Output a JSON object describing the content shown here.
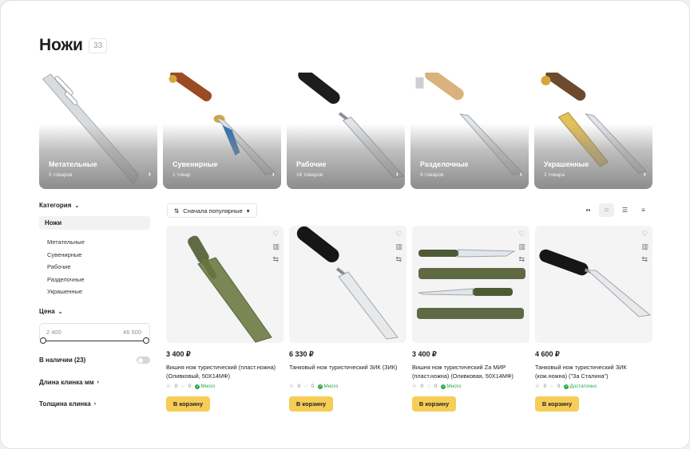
{
  "page": {
    "title": "Ножи",
    "total_count": "33"
  },
  "categories": [
    {
      "name": "Метательные",
      "count": "5 товаров"
    },
    {
      "name": "Сувенирные",
      "count": "1 товар"
    },
    {
      "name": "Рабочие",
      "count": "16 товаров"
    },
    {
      "name": "Разделочные",
      "count": "9 товаров"
    },
    {
      "name": "Украшенные",
      "count": "2 товара"
    }
  ],
  "sidebar": {
    "category_heading": "Категория",
    "active_category": "Ножи",
    "subcategories": [
      "Метательные",
      "Сувенирные",
      "Рабочие",
      "Разделочные",
      "Украшенные"
    ],
    "price_heading": "Цена",
    "price_min": "2 400",
    "price_max": "46 500",
    "in_stock_label": "В наличии (23)",
    "in_stock_on": false,
    "blade_length_label": "Длина клинка мм",
    "blade_thickness_label": "Толщина клинка"
  },
  "toolbar": {
    "sort_label": "Сначала популярные",
    "view_modes": [
      "grid-large-icon",
      "grid-small-icon",
      "list-icon",
      "compact-list-icon"
    ],
    "active_view": "grid-small-icon"
  },
  "products": [
    {
      "price": "3 400 ₽",
      "name": "Вишня нож туристический (пласт.ножна) (Оливковый, 50Х14МФ)",
      "rating": "0",
      "reviews": "0",
      "availability": "Много",
      "button": "В корзину"
    },
    {
      "price": "6 330 ₽",
      "name": "Танковый нож туристический ЗИК (ЗИК)",
      "rating": "0",
      "reviews": "0",
      "availability": "Много",
      "button": "В корзину"
    },
    {
      "price": "3 400 ₽",
      "name": "Вишня нож туристический Za МИР (пласт.ножна) (Оливковая, 50Х14МФ)",
      "rating": "0",
      "reviews": "0",
      "availability": "Много",
      "button": "В корзину"
    },
    {
      "price": "4 600 ₽",
      "name": "Танковый нож туристический ЗИК (кож.ножна) (\"За Сталина\")",
      "rating": "0",
      "reviews": "0",
      "availability": "Достаточно",
      "button": "В корзину"
    }
  ],
  "colors": {
    "accent_button": "#f6cd57",
    "availability_green": "#2aa84a"
  }
}
